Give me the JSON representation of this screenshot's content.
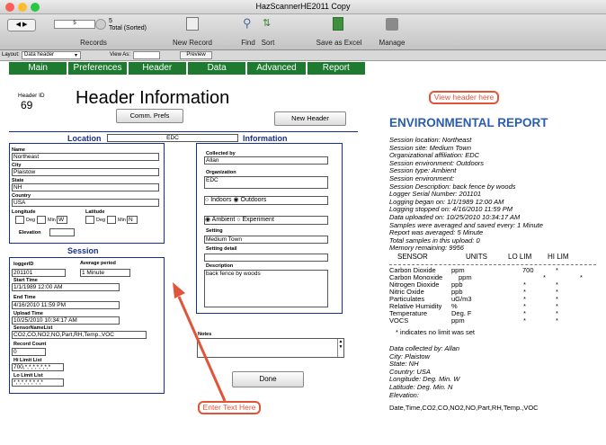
{
  "window": {
    "title": "HazScannerHE2011 Copy"
  },
  "toolbar": {
    "record_num": "5",
    "record_count": "5",
    "record_sorted": "Total (Sorted)",
    "records_label": "Records",
    "new_record": "New Record",
    "find": "Find",
    "sort": "Sort",
    "save_excel": "Save as Excel",
    "manage": "Manage"
  },
  "layoutbar": {
    "layout_label": "Layout:",
    "layout_value": "Data header",
    "view_as": "View As:",
    "preview": "Preview"
  },
  "nav": [
    "Main",
    "Preferences",
    "Header",
    "Data",
    "Advanced",
    "Report"
  ],
  "header": {
    "id_label": "Header ID",
    "id_value": "69",
    "title": "Header Information",
    "comm_prefs": "Comm. Prefs",
    "new_header": "New Header"
  },
  "location": {
    "title": "Location",
    "location_value": "EDC",
    "info_title": "Information",
    "name_label": "Name",
    "name": "Northeast",
    "city_label": "City",
    "city": "Plaistow",
    "state_label": "State",
    "state": "NH",
    "country_label": "Country",
    "country": "USA",
    "longitude_label": "Longitude",
    "latitude_label": "Latitude",
    "deg": "Deg",
    "min": "Min",
    "w": "W",
    "n": "N",
    "elevation_label": "Elevation"
  },
  "info": {
    "collected_by_label": "Collected by",
    "collected_by": "Allan",
    "organization_label": "Organization",
    "organization": "EDC",
    "indoors": "Indoors",
    "outdoors": "Outdoors",
    "ambient": "Ambient",
    "experiment": "Experiment",
    "setting_label": "Setting",
    "setting": "Medium Town",
    "setting_detail_label": "Setting detail",
    "description_label": "Description",
    "description": "back fence by woods"
  },
  "session": {
    "title": "Session",
    "logger_id_label": "loggerID",
    "logger_id": "201101",
    "avg_period_label": "Average period",
    "avg_period": "1 Minute",
    "start_time_label": "Start Time",
    "start_time": "1/1/1989 12:00 AM",
    "end_time_label": "End Time",
    "end_time": "4/16/2010 11:59 PM",
    "upload_time_label": "Upload Time",
    "upload_time": "10/25/2010 10:34:17 AM",
    "sensor_list_label": "SensorNameList",
    "sensor_list": "CO2,CO,NO2,NO,Part,RH,Temp.,VOC",
    "record_count_label": "Record Count",
    "record_count": "0",
    "hi_limit_label": "Hi Limit List",
    "hi_limit": "700,*,*,*,*,*,*,*",
    "lo_limit_label": "Lo Limit List",
    "lo_limit": "*,*,*,*,*,*,*,*"
  },
  "notes": {
    "label": "Notes"
  },
  "done": "Done",
  "callouts": {
    "view_header": "View header here",
    "enter_text": "Enter Text Here"
  },
  "report": {
    "title": "ENVIRONMENTAL REPORT",
    "lines": [
      "Session location: Northeast",
      "Session site: Medium Town",
      "Organizational affiliation: EDC",
      "Session environment: Outdoors",
      "Session type: Ambient",
      "Session environment:",
      "Session Description: back fence by woods",
      "Logger Serial Number: 201101",
      "Logging began on: 1/1/1989 12:00 AM",
      "Logging stopped on: 4/16/2010 11:59 PM",
      "Data uploaded on: 10/25/2010 10:34:17 AM",
      "Samples were averaged and saved every: 1 Minute",
      "Report was averaged: 5 Minute",
      "Total samples in this upload: 0",
      "Memory remaining: 9956"
    ],
    "columns": [
      "SENSOR",
      "UNITS",
      "LO LIM",
      "HI LIM"
    ],
    "rows": [
      [
        "Carbon Dioxide",
        "ppm",
        "700",
        "*"
      ],
      [
        "Carbon Monoxide",
        "ppm",
        "*",
        "*"
      ],
      [
        "Nitrogen Dioxide",
        "ppb",
        "*",
        "*"
      ],
      [
        "Nitric Oxide",
        "ppb",
        "*",
        "*"
      ],
      [
        "Particulates",
        "uG/m3",
        "*",
        "*"
      ],
      [
        "Relative Humidity",
        "%",
        "*",
        "*"
      ],
      [
        "Temperature",
        "Deg. F",
        "*",
        "*"
      ],
      [
        "VOCS",
        "ppm",
        "*",
        "*"
      ]
    ],
    "note": "* indicates no limit was set",
    "collected": [
      "Data collected by: Allan",
      "City: Plaistow",
      "State: NH",
      "Country: USA",
      "Longitude:  Deg.  Min. W",
      "Latitude:  Deg.  Min. N",
      "Elevation:"
    ],
    "footer": "Date,Time,CO2,CO,NO2,NO,Part,RH,Temp.,VOC"
  }
}
